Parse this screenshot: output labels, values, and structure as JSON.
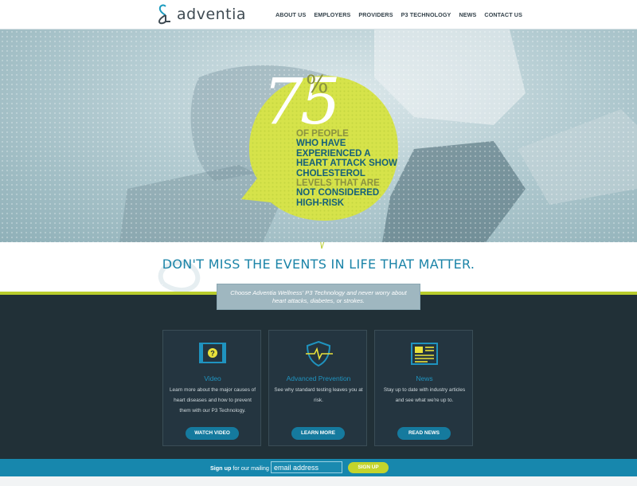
{
  "brand": {
    "name": "adventia"
  },
  "nav": [
    "ABOUT US",
    "EMPLOYERS",
    "PROVIDERS",
    "P3 TECHNOLOGY",
    "NEWS",
    "CONTACT US"
  ],
  "hero": {
    "big_number": "75",
    "percent": "%",
    "line1": "OF PEOPLE",
    "line2": "WHO HAVE EXPERIENCED A HEART ATTACK SHOW CHOLESTEROL",
    "line3a": "LEVELS THAT ARE",
    "line3b": "NOT",
    "line3c": "CONSIDERED",
    "line4": "HIGH-RISK"
  },
  "tagline": "DON'T MISS THE EVENTS IN LIFE THAT MATTER.",
  "callout": "Choose Adventia Wellness' P3 Technology and never worry about heart attacks, diabetes, or strokes.",
  "cards": [
    {
      "title": "Video",
      "desc": "Learn more about the major causes of heart diseases and how to prevent them with our P3 Technology.",
      "button": "WATCH VIDEO",
      "icon": "video-icon"
    },
    {
      "title": "Advanced Prevention",
      "desc": "See why standard testing leaves you at risk.",
      "button": "LEARN MORE",
      "icon": "shield-heartbeat-icon"
    },
    {
      "title": "News",
      "desc": "Stay up to date with industry articles and see what we're up to.",
      "button": "READ NEWS",
      "icon": "newspaper-icon"
    }
  ],
  "signup": {
    "label_bold": "Sign up",
    "label_rest": "for our mailing list:",
    "placeholder": "email address",
    "button": "SIGN UP"
  },
  "colors": {
    "teal": "#1b84a8",
    "lime": "#c3d42c",
    "dark": "#213037"
  }
}
